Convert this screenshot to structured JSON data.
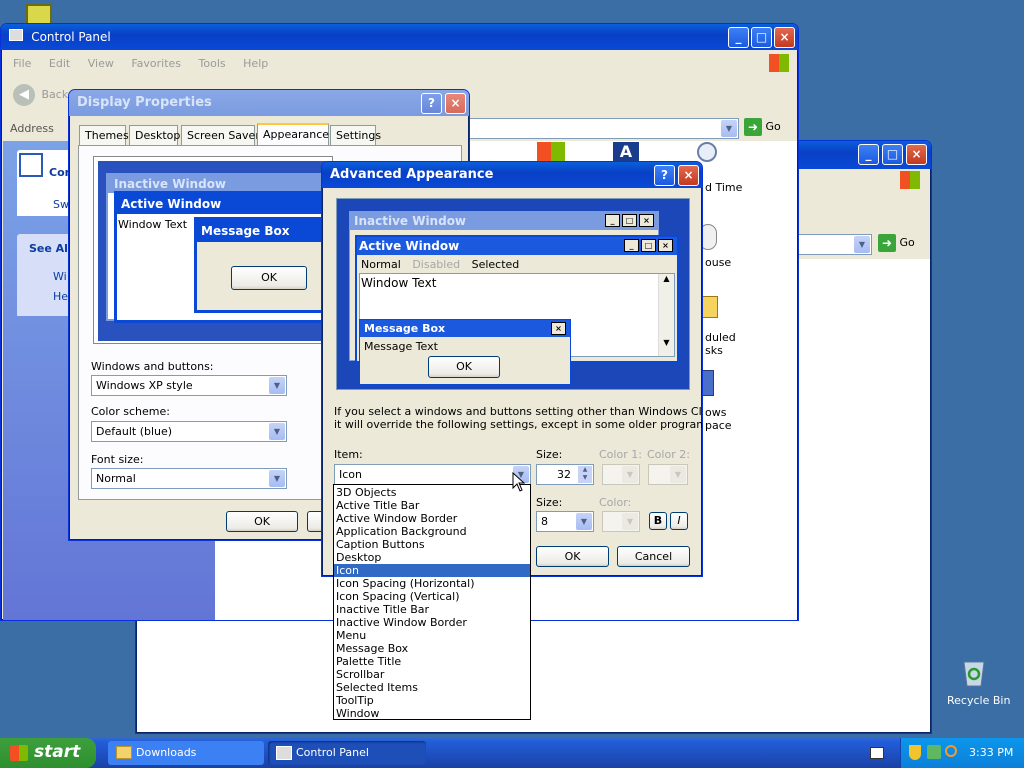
{
  "desktop": {
    "recycle_bin_label": "Recycle Bin"
  },
  "control_panel": {
    "title": "Control Panel",
    "menu": [
      "File",
      "Edit",
      "View",
      "Favorites",
      "Tools",
      "Help"
    ],
    "back_label": "Back",
    "address_label": "Address",
    "go_label": "Go",
    "sidebar_title": "Con",
    "sidebar_switch": "Sw",
    "see_also": "See Als",
    "see_also_items": [
      "Wi",
      "He"
    ],
    "icon_labels": [
      "d Time",
      "ouse",
      "duled",
      "sks",
      "ows",
      "pace"
    ]
  },
  "control_panel_2": {
    "go_label": "Go"
  },
  "display_properties": {
    "title": "Display Properties",
    "tabs": [
      "Themes",
      "Desktop",
      "Screen Saver",
      "Appearance",
      "Settings"
    ],
    "preview": {
      "inactive_title": "Inactive Window",
      "active_title": "Active Window",
      "window_text": "Window Text",
      "message_box_title": "Message Box",
      "ok_label": "OK"
    },
    "windows_buttons_label": "Windows and buttons:",
    "windows_buttons_value": "Windows XP style",
    "color_scheme_label": "Color scheme:",
    "color_scheme_value": "Default (blue)",
    "font_size_label": "Font size:",
    "font_size_value": "Normal",
    "ok_label": "OK"
  },
  "advanced_appearance": {
    "title": "Advanced Appearance",
    "preview": {
      "inactive_title": "Inactive Window",
      "active_title": "Active Window",
      "menu_normal": "Normal",
      "menu_disabled": "Disabled",
      "menu_selected": "Selected",
      "window_text": "Window Text",
      "message_box_title": "Message Box",
      "message_text": "Message Text",
      "ok_label": "OK"
    },
    "info_line1": "If you select a windows and buttons setting other than Windows Classic,",
    "info_line2": "it will override the following settings, except in some older programs.",
    "item_label": "Item:",
    "item_value": "Icon",
    "size_label": "Size:",
    "size_value": "32",
    "color1_label": "Color 1:",
    "color2_label": "Color 2:",
    "font_size_label": "Size:",
    "font_size_value": "8",
    "font_color_label": "Color:",
    "bold_label": "B",
    "italic_label": "I",
    "ok_label": "OK",
    "cancel_label": "Cancel",
    "selected_index": 6,
    "items": [
      "3D Objects",
      "Active Title Bar",
      "Active Window Border",
      "Application Background",
      "Caption Buttons",
      "Desktop",
      "Icon",
      "Icon Spacing (Horizontal)",
      "Icon Spacing (Vertical)",
      "Inactive Title Bar",
      "Inactive Window Border",
      "Menu",
      "Message Box",
      "Palette Title",
      "Scrollbar",
      "Selected Items",
      "ToolTip",
      "Window"
    ]
  },
  "taskbar": {
    "start_label": "start",
    "tasks": [
      "Downloads",
      "Control Panel"
    ],
    "clock": "3:33 PM"
  },
  "colors": {
    "desktop": "#3a6ea5",
    "title_active": "#0a5fdc",
    "selection": "#316ac5",
    "taskbar": "#245edb"
  }
}
